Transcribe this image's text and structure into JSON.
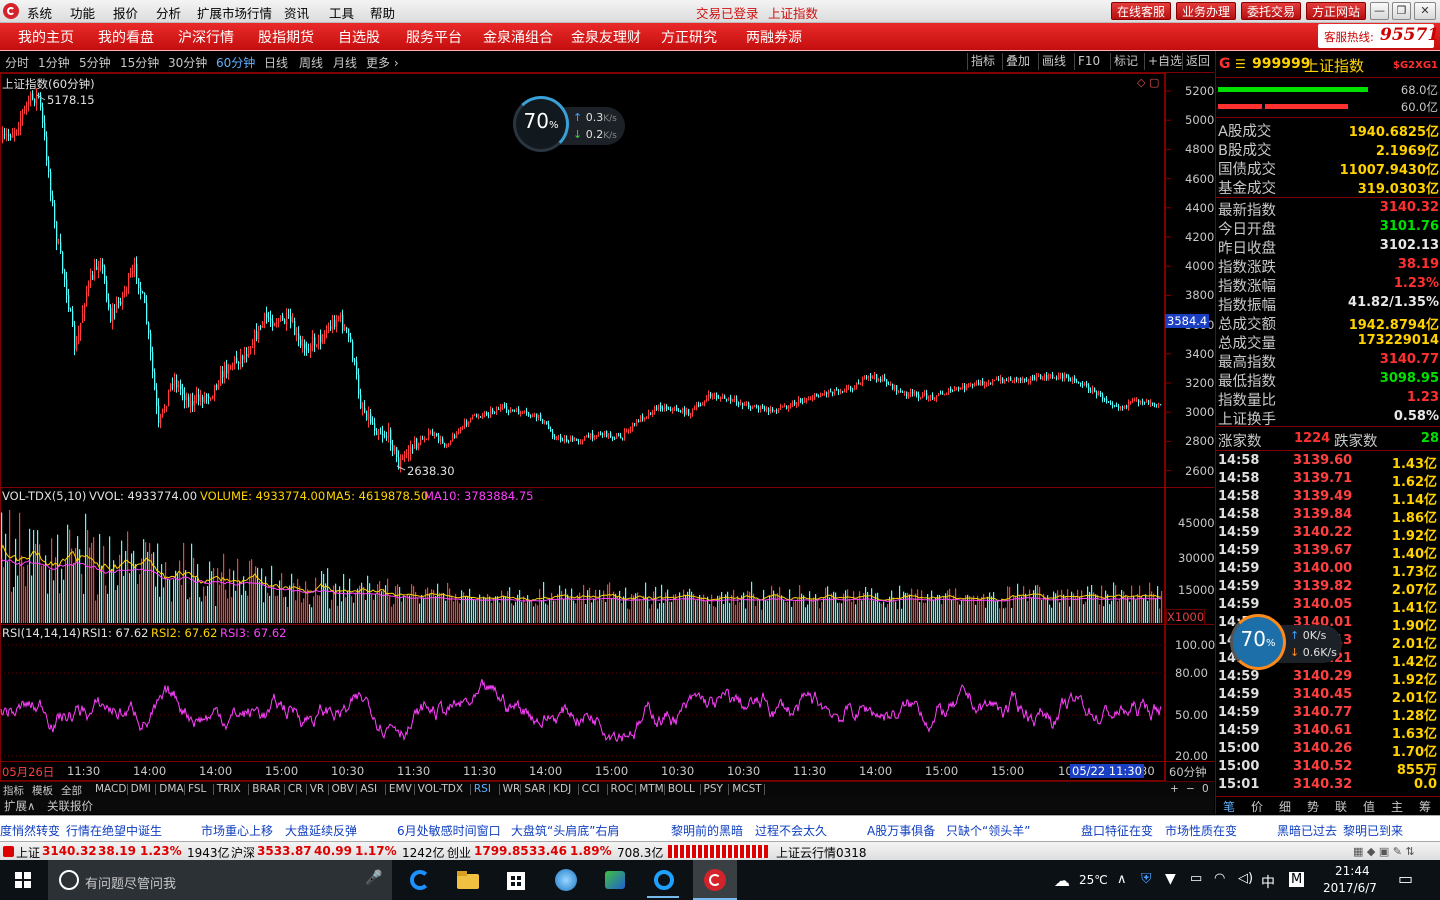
{
  "title_bar": {
    "menus": [
      "系统",
      "功能",
      "报价",
      "分析",
      "扩展市场行情",
      "资讯",
      "工具",
      "帮助"
    ],
    "status": [
      "交易已登录",
      "上证指数"
    ],
    "buttons": [
      "在线客服",
      "业务办理",
      "委托交易",
      "方正网站"
    ],
    "window_controls": [
      "—",
      "❐",
      "▣",
      "✕"
    ]
  },
  "nav": {
    "items": [
      "我的主页",
      "我的看盘",
      "沪深行情",
      "股指期货",
      "自选股",
      "服务平台",
      "金泉涌组合",
      "金泉友理财",
      "方正研究",
      "两融券源"
    ],
    "hotline_label": "客服热线:",
    "hotline_number": "95571"
  },
  "periods": [
    "分时",
    "1分钟",
    "5分钟",
    "15分钟",
    "30分钟",
    "60分钟",
    "日线",
    "周线",
    "月线",
    "更多 ›"
  ],
  "active_period": "60分钟",
  "tools": [
    "指标",
    "叠加",
    "画线",
    "F10",
    "标记",
    "+自选",
    "返回"
  ],
  "main_chart": {
    "title": "上证指数(60分钟)",
    "high_label": "5178.15",
    "low_label": "2638.30",
    "price_marker": "3584.4",
    "y_ticks": [
      "5200",
      "5000",
      "4800",
      "4600",
      "4400",
      "4200",
      "4000",
      "3800",
      "3600",
      "3400",
      "3200",
      "3000",
      "2800",
      "2600"
    ]
  },
  "volume_panel": {
    "label": "VOL-TDX(5,10)",
    "vvol": "VVOL: 4933774.00",
    "volume": "VOLUME: 4933774.00",
    "ma5": "MA5: 4619878.50",
    "ma10": "MA10: 3783884.75",
    "y_ticks": [
      "45000",
      "30000",
      "15000"
    ],
    "unit": "X1000"
  },
  "rsi_panel": {
    "label": "RSI(14,14,14)",
    "rsi1": "RSI1: 67.62",
    "rsi2": "RSI2: 67.62",
    "rsi3": "RSI3: 67.62",
    "y_ticks": [
      "100.00",
      "80.00",
      "50.00",
      "20.00"
    ]
  },
  "x_axis": {
    "labels": [
      "05月26日",
      "11:30",
      "14:00",
      "14:00",
      "15:00",
      "10:30",
      "11:30",
      "11:30",
      "14:00",
      "15:00",
      "10:30",
      "10:30",
      "11:30",
      "14:00",
      "15:00",
      "15:00",
      "10",
      "30"
    ],
    "cursor_label": "05/22 11:30",
    "period": "60分钟"
  },
  "indicator_tabs": {
    "side": [
      "指标",
      "模板",
      "全部"
    ],
    "items": [
      "MACD",
      "DMI",
      "DMA",
      "FSL",
      "TRIX",
      "BRAR",
      "CR",
      "VR",
      "OBV",
      "ASI",
      "EMV",
      "VOL-TDX",
      "RSI",
      "WR",
      "SAR",
      "KDJ",
      "CCI",
      "ROC",
      "MTM",
      "BOLL",
      "PSY",
      "MCST"
    ],
    "active": "RSI",
    "controls": [
      "+",
      "−",
      "0"
    ]
  },
  "ext_bar": [
    "扩展∧",
    "关联报价"
  ],
  "speed_widgets": [
    {
      "pct": "70",
      "up": "0.3",
      "down": "0.2",
      "unit": "K/s"
    },
    {
      "pct": "70",
      "up": "0K/s",
      "down": "0.6K/s"
    }
  ],
  "quote_panel": {
    "header": {
      "code": "999999",
      "name": "上证指数",
      "badge": "$G2XG1",
      "glyph": "G",
      "menu": "☰"
    },
    "bars": [
      {
        "value": "68.0亿",
        "ratio": 0.68
      },
      {
        "value": "60.0亿",
        "ratio": 0.6
      }
    ],
    "colors": {
      "green": "#00e000",
      "red": "#ff3030",
      "yellow": "#ffd200",
      "white": "#e8e8e8"
    },
    "turnover": [
      {
        "k": "A股成交",
        "v": "1940.6825亿"
      },
      {
        "k": "B股成交",
        "v": "2.1969亿"
      },
      {
        "k": "国债成交",
        "v": "11007.9430亿"
      },
      {
        "k": "基金成交",
        "v": "319.0303亿"
      }
    ],
    "stats": [
      {
        "k": "最新指数",
        "v": "3140.32",
        "c": "red"
      },
      {
        "k": "今日开盘",
        "v": "3101.76",
        "c": "green"
      },
      {
        "k": "昨日收盘",
        "v": "3102.13",
        "c": "white"
      },
      {
        "k": "指数涨跌",
        "v": "38.19",
        "c": "red"
      },
      {
        "k": "指数涨幅",
        "v": "1.23%",
        "c": "red"
      },
      {
        "k": "指数振幅",
        "v": "41.82/1.35%",
        "c": "white"
      },
      {
        "k": "总成交额",
        "v": "1942.8794亿",
        "c": "yellow"
      },
      {
        "k": "总成交量",
        "v": "173229014",
        "c": "yellow"
      },
      {
        "k": "最高指数",
        "v": "3140.77",
        "c": "red"
      },
      {
        "k": "最低指数",
        "v": "3098.95",
        "c": "green"
      },
      {
        "k": "指数量比",
        "v": "1.23",
        "c": "red"
      },
      {
        "k": "上证换手",
        "v": "0.58%",
        "c": "white"
      }
    ],
    "advance_label": "涨家数",
    "advance": "1224",
    "decline_label": "跌家数",
    "decline": "28",
    "ticks": [
      {
        "t": "14:58",
        "p": "3139.60",
        "a": "1.43亿"
      },
      {
        "t": "14:58",
        "p": "3139.71",
        "a": "1.62亿"
      },
      {
        "t": "14:58",
        "p": "3139.49",
        "a": "1.14亿"
      },
      {
        "t": "14:58",
        "p": "3139.84",
        "a": "1.86亿"
      },
      {
        "t": "14:59",
        "p": "3140.22",
        "a": "1.92亿"
      },
      {
        "t": "14:59",
        "p": "3139.67",
        "a": "1.40亿"
      },
      {
        "t": "14:59",
        "p": "3140.00",
        "a": "1.73亿"
      },
      {
        "t": "14:59",
        "p": "3139.82",
        "a": "2.07亿"
      },
      {
        "t": "14:59",
        "p": "3140.05",
        "a": "1.41亿"
      },
      {
        "t": "14:59",
        "p": "3140.01",
        "a": "1.90亿"
      },
      {
        "t": "14:59",
        "p": "3140.13",
        "a": "2.01亿"
      },
      {
        "t": "14:59",
        "p": "3140.21",
        "a": "1.42亿"
      },
      {
        "t": "14:59",
        "p": "3140.29",
        "a": "1.92亿"
      },
      {
        "t": "14:59",
        "p": "3140.45",
        "a": "2.01亿"
      },
      {
        "t": "14:59",
        "p": "3140.77",
        "a": "1.28亿"
      },
      {
        "t": "14:59",
        "p": "3140.61",
        "a": "1.63亿"
      },
      {
        "t": "15:00",
        "p": "3140.26",
        "a": "1.70亿"
      },
      {
        "t": "15:00",
        "p": "3140.52",
        "a": "855万"
      },
      {
        "t": "15:01",
        "p": "3140.32",
        "a": "0.0"
      }
    ],
    "bottom_tabs": [
      "笔",
      "价",
      "细",
      "势",
      "联",
      "值",
      "主",
      "筹"
    ]
  },
  "news": [
    "度悄然转变",
    "行情在绝望中诞生",
    "市场重心上移",
    "大盘延续反弹",
    "6月处敏感时间窗口",
    "大盘筑“头肩底”右肩",
    "黎明前的黑暗",
    "过程不会太久",
    "A股万事俱备",
    "只缺个“领头羊”",
    "盘口特征在变",
    "市场性质在变",
    "黑暗已过去",
    "黎明已到来"
  ],
  "status_bar": {
    "sh_name": "上证",
    "sh_price": "3140.32",
    "sh_change": "38.19",
    "sh_pct": "1.23%",
    "sh_amount": "1943亿",
    "sz_name": "沪深",
    "sz_price": "3533.87",
    "sz_change": "40.99",
    "sz_pct": "1.17%",
    "sz_amount": "1242亿",
    "cy_name": "创业",
    "cy_price": "1799.85",
    "cy_change": "33.46",
    "cy_pct": "1.89%",
    "cy_amount": "708.3亿",
    "cloud": "上证云行情0318"
  },
  "taskbar": {
    "search_placeholder": "有问题尽管问我",
    "weather": "25℃",
    "ime": "中",
    "ime2": "M",
    "time": "21:44",
    "date": "2017/6/7"
  }
}
